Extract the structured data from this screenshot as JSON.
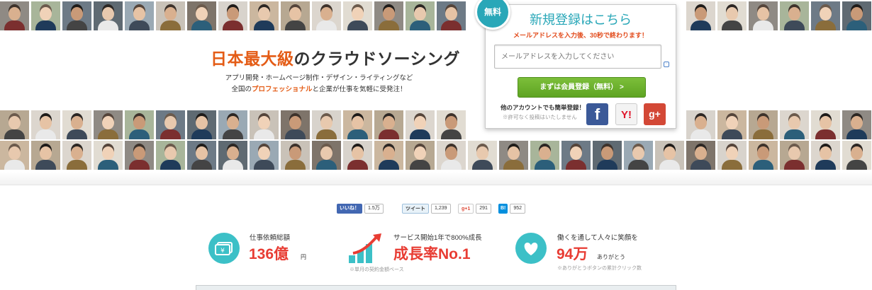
{
  "hero": {
    "headline_accent": "日本最大級",
    "headline_rest": "のクラウドソーシング",
    "subline1": "アプリ開発・ホームページ制作・デザイン・ライティングなど",
    "subline2_pre": "全国の",
    "subline2_accent": "プロフェッショナル",
    "subline2_post": "と企業が仕事を気軽に受発注！"
  },
  "signup": {
    "badge": "無料",
    "title": "新規登録はこちら",
    "note": "メールアドレスを入力後、30秒で終わります！",
    "email_placeholder": "メールアドレスを入力してください",
    "register_label": "まずは会員登録（無料） >",
    "other_label": "他のアカウントでも簡単登録！",
    "other_note": "※許可なく投稿はいたしません",
    "facebook_glyph": "f",
    "yahoo_glyph": "Y!",
    "google_glyph": "g+"
  },
  "share": {
    "facebook_label": "いいね！",
    "facebook_count": "1.5万",
    "tweet_label": "ツイート",
    "tweet_count": "1,239",
    "gplus_label": "g+1",
    "gplus_count": "291",
    "hatena_label": "B!",
    "hatena_count": "952"
  },
  "stats": [
    {
      "label": "仕事依頼総額",
      "value": "136億",
      "unit": "円",
      "note": ""
    },
    {
      "label": "サービス開始1年で800%成長",
      "value": "成長率No.1",
      "unit": "",
      "note": "※単月の契約金額ベース"
    },
    {
      "label": "働くを通して人々に笑顔を",
      "value": "94万",
      "unit": "ありがとう",
      "note": "※ありがとうボタンの累計クリック数"
    }
  ],
  "colors": {
    "accent_orange": "#e45c16",
    "teal": "#29a7b8",
    "stat_red": "#e83c33",
    "button_green": "#6cb12e"
  }
}
